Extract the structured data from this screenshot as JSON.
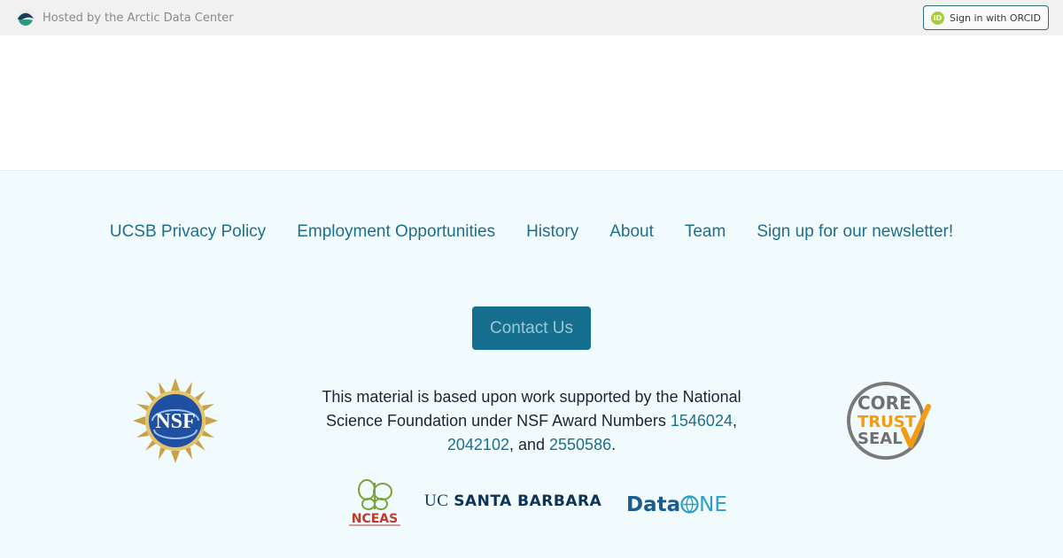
{
  "topbar": {
    "hosted_text": "Hosted by the Arctic Data Center",
    "orcid_label": "Sign in with ORCID",
    "orcid_icon_text": "iD"
  },
  "footer": {
    "links": [
      "UCSB Privacy Policy",
      "Employment Opportunities",
      "History",
      "About",
      "Team",
      "Sign up for our newsletter!"
    ],
    "contact_label": "Contact Us",
    "funding": {
      "prefix": "This material is based upon work supported by the National Science Foundation under NSF Award Numbers ",
      "award1": "1546024",
      "sep1": ", ",
      "award2": "2042102",
      "sep2": ", and ",
      "award3": "2550586",
      "suffix": "."
    },
    "logos": {
      "nsf": "NSF",
      "core_trust_seal": [
        "CORE",
        "TRUST",
        "SEAL"
      ],
      "nceas": "NCEAS",
      "ucsb_uc": "UC",
      "ucsb_name": "SANTA BARBARA",
      "dataone_a": "Data",
      "dataone_b": "NE"
    }
  },
  "colors": {
    "link": "#1f6f8b",
    "button_bg": "#166f8e",
    "footer_bg": "#f1fafc",
    "orcid_green": "#a6ce39"
  }
}
